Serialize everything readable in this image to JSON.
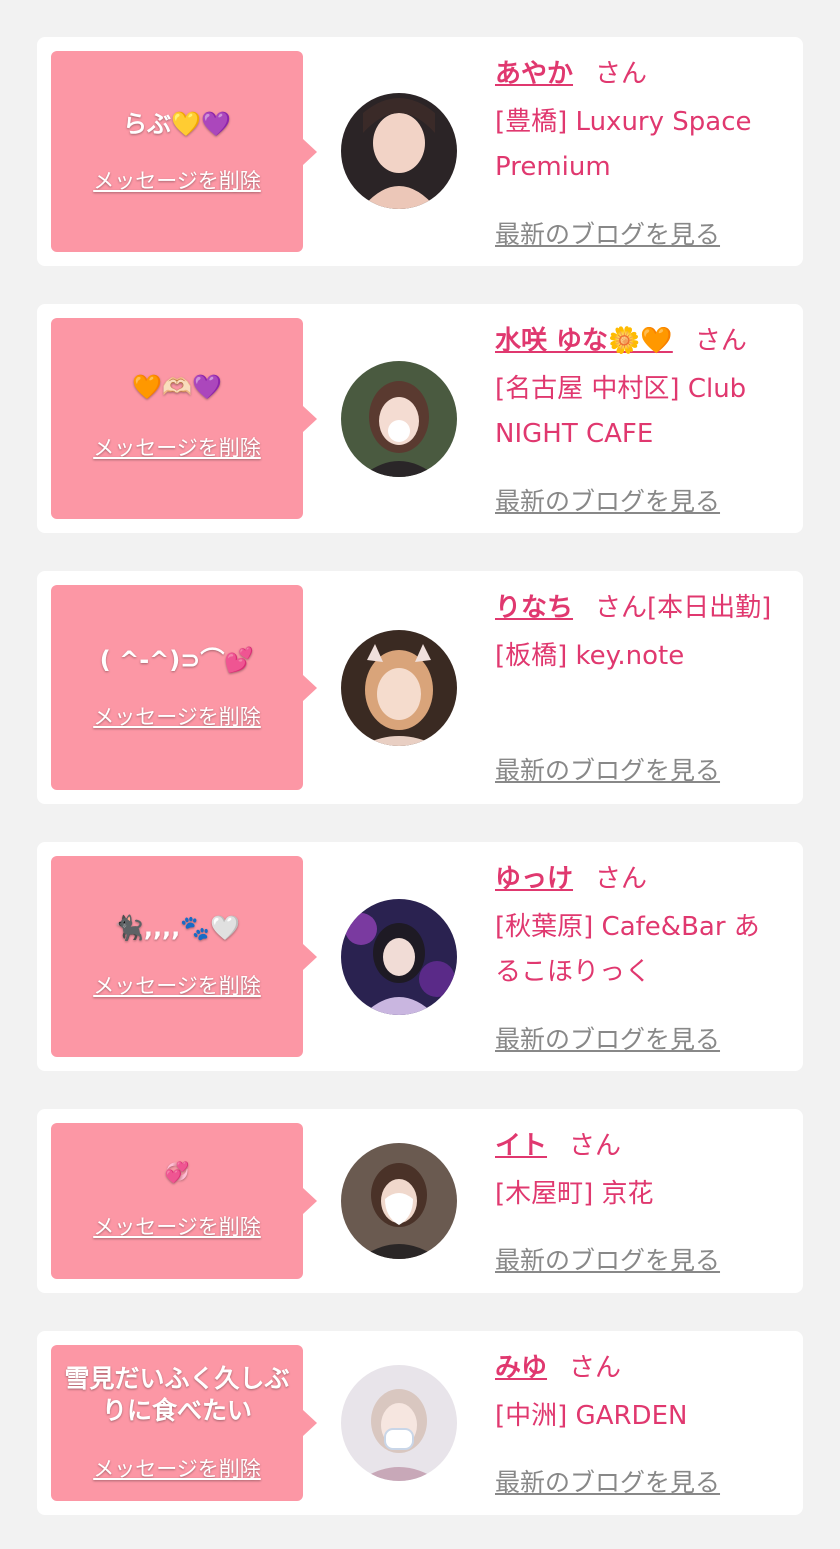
{
  "cards": [
    {
      "message": "らぶ💛💜",
      "delete": "メッセージを削除",
      "name": "あやか",
      "suffix": "さん",
      "shop": "[豊橋] Luxury Space Premium",
      "blog": "最新のブログを見る"
    },
    {
      "message": "🧡🫶🏻💜",
      "delete": "メッセージを削除",
      "name": "水咲 ゆな🌼🧡",
      "suffix": "さん",
      "shop": "[名古屋 中村区] Club NIGHT CAFE",
      "blog": "最新のブログを見る"
    },
    {
      "message": "( ^-^)⊃⌒💕",
      "delete": "メッセージを削除",
      "name": "りなち",
      "suffix": "さん[本日出勤]",
      "shop": "[板橋] key.note",
      "blog": "最新のブログを見る"
    },
    {
      "message": "🐈‍⬛,,,,🐾🤍",
      "delete": "メッセージを削除",
      "name": "ゆっけ",
      "suffix": "さん",
      "shop": "[秋葉原] Cafe&Bar あるこほりっく",
      "blog": "最新のブログを見る"
    },
    {
      "message": "💞",
      "delete": "メッセージを削除",
      "name": "イト",
      "suffix": "さん",
      "shop": "[木屋町] 京花",
      "blog": "最新のブログを見る"
    },
    {
      "message": "雪見だいふく久しぶりに食べたい",
      "delete": "メッセージを削除",
      "name": "みゆ",
      "suffix": "さん",
      "shop": "[中洲] GARDEN",
      "blog": "最新のブログを見る"
    }
  ],
  "colors": {
    "accent": "#e0386f",
    "bubble": "#fc97a5",
    "background": "#f2f2f2",
    "link_gray": "#888888"
  }
}
